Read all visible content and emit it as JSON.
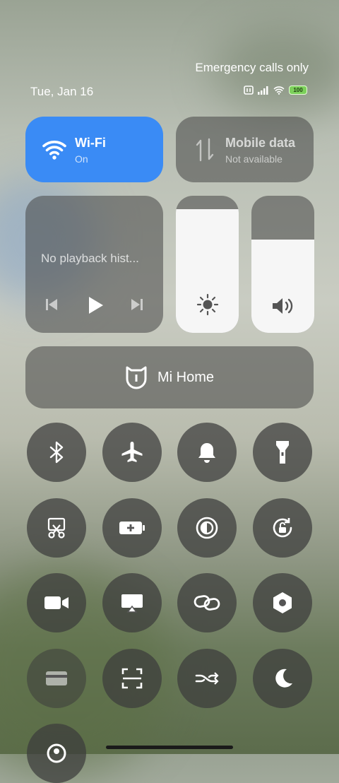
{
  "status": {
    "carrier_text": "Emergency calls only",
    "date": "Tue, Jan 16",
    "battery": "100"
  },
  "wifi_tile": {
    "title": "Wi-Fi",
    "subtitle": "On",
    "color": "#3a8bf5"
  },
  "mobile_tile": {
    "title": "Mobile data",
    "subtitle": "Not available"
  },
  "media": {
    "text": "No playback hist..."
  },
  "brightness": {
    "level": 0.9
  },
  "volume": {
    "level": 0.68
  },
  "mi_home": {
    "label": "Mi Home"
  },
  "toggles": [
    {
      "name": "bluetooth",
      "icon": "bluetooth-icon"
    },
    {
      "name": "airplane-mode",
      "icon": "airplane-icon"
    },
    {
      "name": "sound",
      "icon": "bell-icon"
    },
    {
      "name": "flashlight",
      "icon": "flashlight-icon"
    },
    {
      "name": "screenshot",
      "icon": "scissors-icon"
    },
    {
      "name": "battery-saver",
      "icon": "battery-plus-icon"
    },
    {
      "name": "dark-mode",
      "icon": "contrast-icon"
    },
    {
      "name": "rotation-lock",
      "icon": "rotation-lock-icon"
    },
    {
      "name": "screen-recorder",
      "icon": "video-camera-icon"
    },
    {
      "name": "cast",
      "icon": "cast-icon"
    },
    {
      "name": "link",
      "icon": "link-icon"
    },
    {
      "name": "settings",
      "icon": "hexagon-settings-icon"
    },
    {
      "name": "card",
      "icon": "card-icon"
    },
    {
      "name": "scanner",
      "icon": "scan-icon"
    },
    {
      "name": "data-saver",
      "icon": "shuffle-icon"
    },
    {
      "name": "do-not-disturb",
      "icon": "moon-icon"
    },
    {
      "name": "location",
      "icon": "location-icon"
    }
  ]
}
